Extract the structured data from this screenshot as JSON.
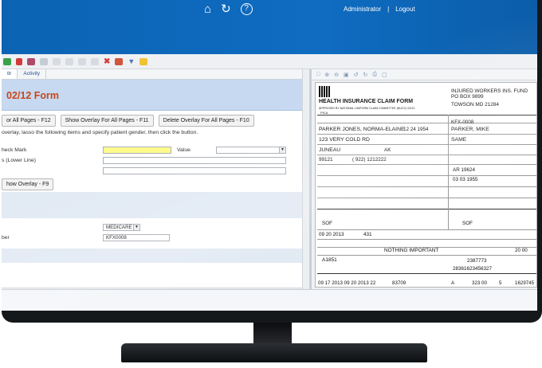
{
  "header": {
    "admin_label": "Administrator",
    "separator": "|",
    "logout_label": "Logout",
    "icons": [
      "home-icon",
      "refresh-icon",
      "help-icon"
    ]
  },
  "tabs": [
    {
      "label": "tlr"
    },
    {
      "label": "Activity"
    }
  ],
  "form": {
    "title": "02/12 Form",
    "buttons": {
      "overlay_all": "or All Pages - F12",
      "show_overlay_all": "Show Overlay For All Pages - F11",
      "delete_overlay_all": "Delete Overlay For All Pages - F10",
      "show_overlay": "how Overlay - F9"
    },
    "instruction": "overlay, lasso the following items and specify patient gender, then click the button.",
    "labels": {
      "check_mark": "heck Mark",
      "value": "Value",
      "lower_line": "s (Lower Line)",
      "member": "ber"
    },
    "fields": {
      "payer_value": "MEDICARE",
      "member_value": "KFX0008"
    }
  },
  "claim": {
    "title": "HEALTH INSURANCE CLAIM FORM",
    "approved": "APPROVED BY NATIONAL UNIFORM CLAIM COMMITTEE (NUCC) 02/12",
    "pica": "PICA",
    "insurer_name": "INJURED WORKERS INS. FUND",
    "insurer_box": "PO BOX 9899",
    "insurer_city": "TOWSON MD 21284",
    "insured_id": "KFX-0008",
    "patient_name": "PARKER JONES, NORMA-ELAINE",
    "birth": "12 24 1954",
    "insured_name": "PARKER, MIKE",
    "patient_address": "123 VERY COLD RD",
    "insured_address": "SAME",
    "city": "JUNEAU",
    "state": "AK",
    "zip": "99121",
    "phone": "( 922) 1212222",
    "insured_group": "AR 19624",
    "insured_birth": "03 03 1955",
    "sig1": "SOF",
    "sig2": "SOF",
    "date_current": "09 20 2013",
    "qual": "431",
    "nothing_important": "NOTHING IMPORTANT",
    "diag": "A1851",
    "charges": "20 00",
    "ref_no": "2387773",
    "prior_auth": "28361623456327",
    "line1": "09 17 2013 09 20 2013 22",
    "cpt": "83709",
    "pointer": "A",
    "line_charge": "323 00",
    "units": "5",
    "npi": "1629745"
  }
}
